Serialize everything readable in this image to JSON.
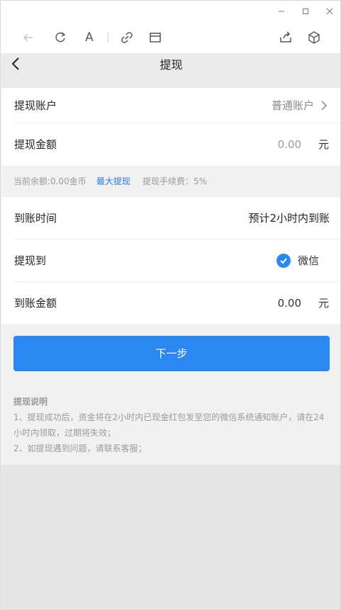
{
  "window": {
    "controls": {
      "minimize": "—",
      "maximize": "□",
      "close": "×"
    }
  },
  "toolbar": {
    "icons": [
      "back-icon",
      "refresh-icon",
      "font-icon",
      "link-icon",
      "window-icon",
      "share-icon",
      "cube-icon"
    ],
    "font_glyph": "A"
  },
  "nav": {
    "title": "提现"
  },
  "form": {
    "account": {
      "label": "提现账户",
      "value": "普通账户"
    },
    "amount": {
      "label": "提现金额",
      "placeholder": "0.00",
      "unit": "元"
    },
    "info": {
      "balance": "当前余额:0.00金币",
      "max": "最大提现",
      "fee": "提现手续费：5%"
    },
    "arrival_time": {
      "label": "到账时间",
      "value": "预计2小时内到账"
    },
    "withdraw_to": {
      "label": "提现到",
      "value": "微信"
    },
    "received": {
      "label": "到账金额",
      "value": "0.00",
      "unit": "元"
    }
  },
  "next_button": "下一步",
  "notes": {
    "title": "提现说明",
    "line1": "1、提现成功后，资金将在2小时内已现金红包发至您的微信系统通知账户，请在24小时内领取，过期将失效；",
    "line2": "2、如提现遇到问题，请联系客服；"
  },
  "colors": {
    "accent": "#2b88f0",
    "link": "#2b7ae0",
    "background": "#f1f1f1"
  }
}
